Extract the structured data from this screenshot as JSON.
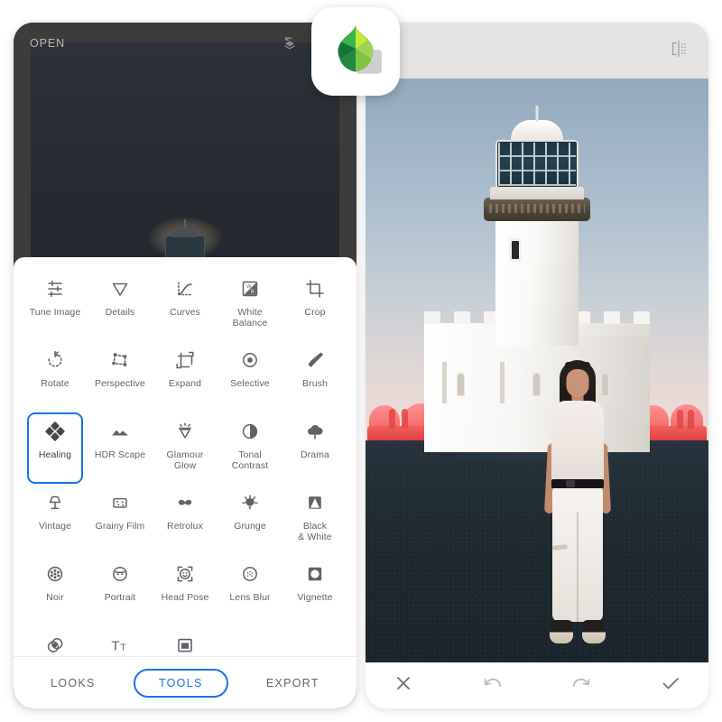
{
  "app": {
    "name": "Snapseed",
    "logo_icon": "snapseed-leaf-logo"
  },
  "editor_panel": {
    "header": {
      "open_label": "OPEN",
      "stacks_icon": "stacks-revert-icon",
      "info_icon": "info-circle-icon"
    },
    "tools_sheet": {
      "tools": [
        {
          "label": "Tune Image",
          "icon": "tune-sliders-icon",
          "selected": false
        },
        {
          "label": "Details",
          "icon": "details-triangle-icon",
          "selected": false
        },
        {
          "label": "Curves",
          "icon": "curves-icon",
          "selected": false
        },
        {
          "label": "White\nBalance",
          "icon": "white-balance-icon",
          "selected": false
        },
        {
          "label": "Crop",
          "icon": "crop-icon",
          "selected": false
        },
        {
          "label": "Rotate",
          "icon": "rotate-icon",
          "selected": false
        },
        {
          "label": "Perspective",
          "icon": "perspective-icon",
          "selected": false
        },
        {
          "label": "Expand",
          "icon": "expand-icon",
          "selected": false
        },
        {
          "label": "Selective",
          "icon": "selective-icon",
          "selected": false
        },
        {
          "label": "Brush",
          "icon": "brush-icon",
          "selected": false
        },
        {
          "label": "Healing",
          "icon": "healing-patch-icon",
          "selected": true
        },
        {
          "label": "HDR Scape",
          "icon": "hdr-mountains-icon",
          "selected": false
        },
        {
          "label": "Glamour\nGlow",
          "icon": "glamour-glow-icon",
          "selected": false
        },
        {
          "label": "Tonal\nContrast",
          "icon": "tonal-contrast-icon",
          "selected": false
        },
        {
          "label": "Drama",
          "icon": "drama-cloud-icon",
          "selected": false
        },
        {
          "label": "Vintage",
          "icon": "vintage-lamp-icon",
          "selected": false
        },
        {
          "label": "Grainy Film",
          "icon": "grainy-film-icon",
          "selected": false
        },
        {
          "label": "Retrolux",
          "icon": "retrolux-icon",
          "selected": false
        },
        {
          "label": "Grunge",
          "icon": "grunge-icon",
          "selected": false
        },
        {
          "label": "Black\n& White",
          "icon": "black-white-icon",
          "selected": false
        },
        {
          "label": "Noir",
          "icon": "noir-reel-icon",
          "selected": false
        },
        {
          "label": "Portrait",
          "icon": "portrait-face-icon",
          "selected": false
        },
        {
          "label": "Head Pose",
          "icon": "head-pose-icon",
          "selected": false
        },
        {
          "label": "Lens Blur",
          "icon": "lens-blur-icon",
          "selected": false
        },
        {
          "label": "Vignette",
          "icon": "vignette-icon",
          "selected": false
        },
        {
          "label": "Double\nExposure",
          "icon": "double-exposure-icon",
          "selected": false
        },
        {
          "label": "Text",
          "icon": "text-icon",
          "selected": false
        },
        {
          "label": "Frames",
          "icon": "frames-icon",
          "selected": false
        }
      ]
    },
    "bottom_nav": {
      "items": [
        {
          "label": "LOOKS",
          "active": false
        },
        {
          "label": "TOOLS",
          "active": true
        },
        {
          "label": "EXPORT",
          "active": false
        }
      ]
    }
  },
  "preview_panel": {
    "header": {
      "compare_icon": "compare-split-icon"
    },
    "photo": {
      "description": "Woman standing in front of a white lighthouse at dusk",
      "subject": "white lighthouse tower with dark lantern room",
      "foreground": "woman in white t-shirt, black belt and white ripped jeans with black sandals",
      "ground": "dark grey asphalt",
      "background_objects": "red benches with figures",
      "sky_colors": [
        "#93a9bd",
        "#c6cfd6",
        "#f0dcd8"
      ]
    },
    "footer": {
      "close_icon": "close-x-icon",
      "undo_icon": "undo-arrow-icon",
      "redo_icon": "redo-arrow-icon",
      "confirm_icon": "confirm-check-icon"
    }
  },
  "colors": {
    "accent_blue": "#1a73e8",
    "panel_dark": "#3c3c3c",
    "sheet_white": "#ffffff",
    "preview_header_grey": "#e4e4e4",
    "label_grey": "#5f6368",
    "logo_green_dark": "#1f8a3d",
    "logo_green_mid": "#3ab54a",
    "logo_green_light": "#8bd04a",
    "logo_green_lime": "#c2e838"
  }
}
